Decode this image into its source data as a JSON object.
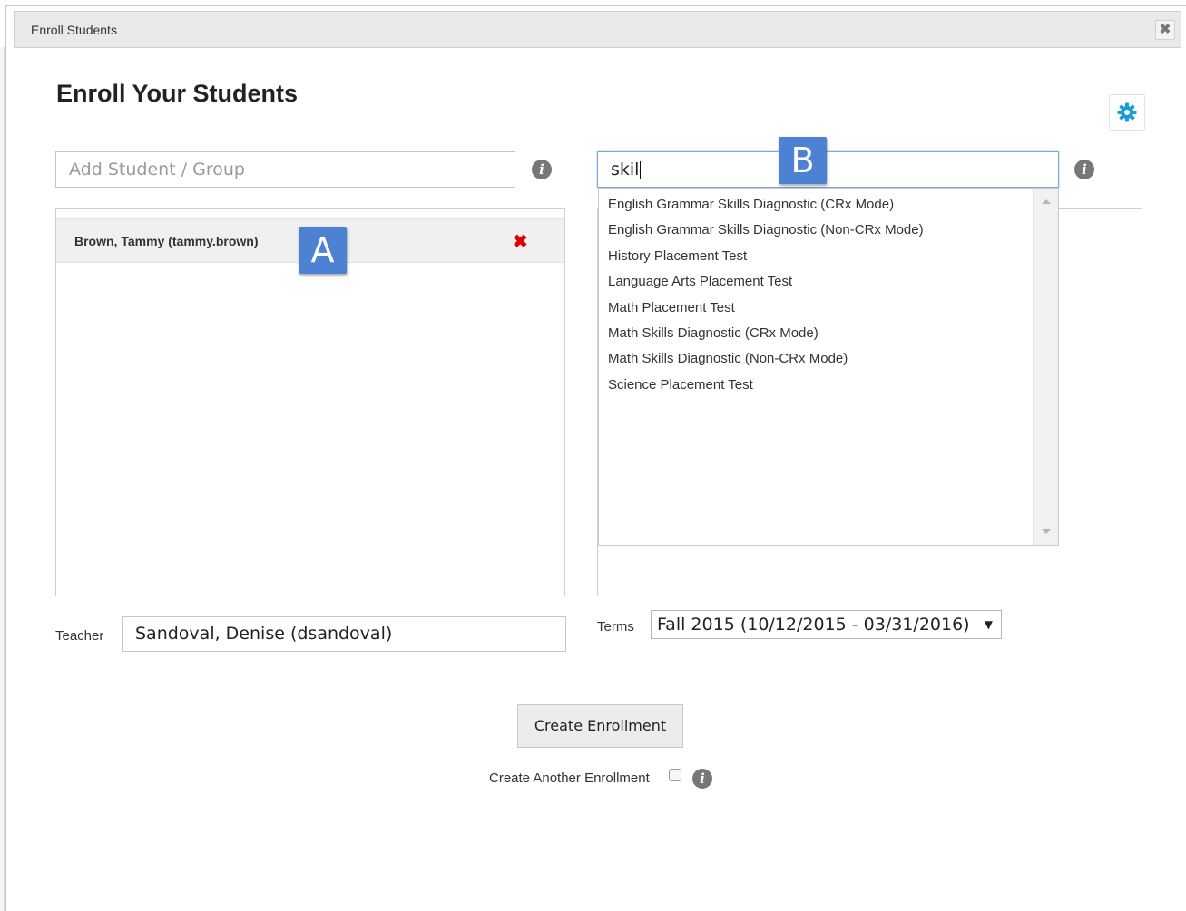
{
  "window": {
    "title": "Enroll Students",
    "close_glyph": "✖"
  },
  "page": {
    "heading": "Enroll Your Students"
  },
  "icons": {
    "settings": "gear-icon",
    "info": "info-icon",
    "remove": "remove-icon",
    "info_glyph": "i",
    "remove_glyph": "✖"
  },
  "student_search": {
    "placeholder": "Add Student / Group",
    "value": ""
  },
  "selected_students": [
    {
      "name": "Brown, Tammy (tammy.brown)"
    }
  ],
  "assessment_search": {
    "value": "skil"
  },
  "assessment_suggestions": [
    "English Grammar Skills Diagnostic (CRx Mode)",
    "English Grammar Skills Diagnostic (Non-CRx Mode)",
    "History Placement Test",
    "Language Arts Placement Test",
    "Math Placement Test",
    "Math Skills Diagnostic (CRx Mode)",
    "Math Skills Diagnostic (Non-CRx Mode)",
    "Science Placement Test"
  ],
  "callouts": {
    "a": "A",
    "b": "B"
  },
  "teacher": {
    "label": "Teacher",
    "value": "Sandoval, Denise (dsandoval)"
  },
  "terms": {
    "label": "Terms",
    "selected": "Fall 2015 (10/12/2015 - 03/31/2016)",
    "arrow": "▼"
  },
  "actions": {
    "create_label": "Create Enrollment",
    "another_label": "Create Another Enrollment",
    "another_checked": false
  },
  "colors": {
    "accent": "#1a9bd7",
    "callout": "#4c81d4",
    "remove": "#e00000"
  }
}
